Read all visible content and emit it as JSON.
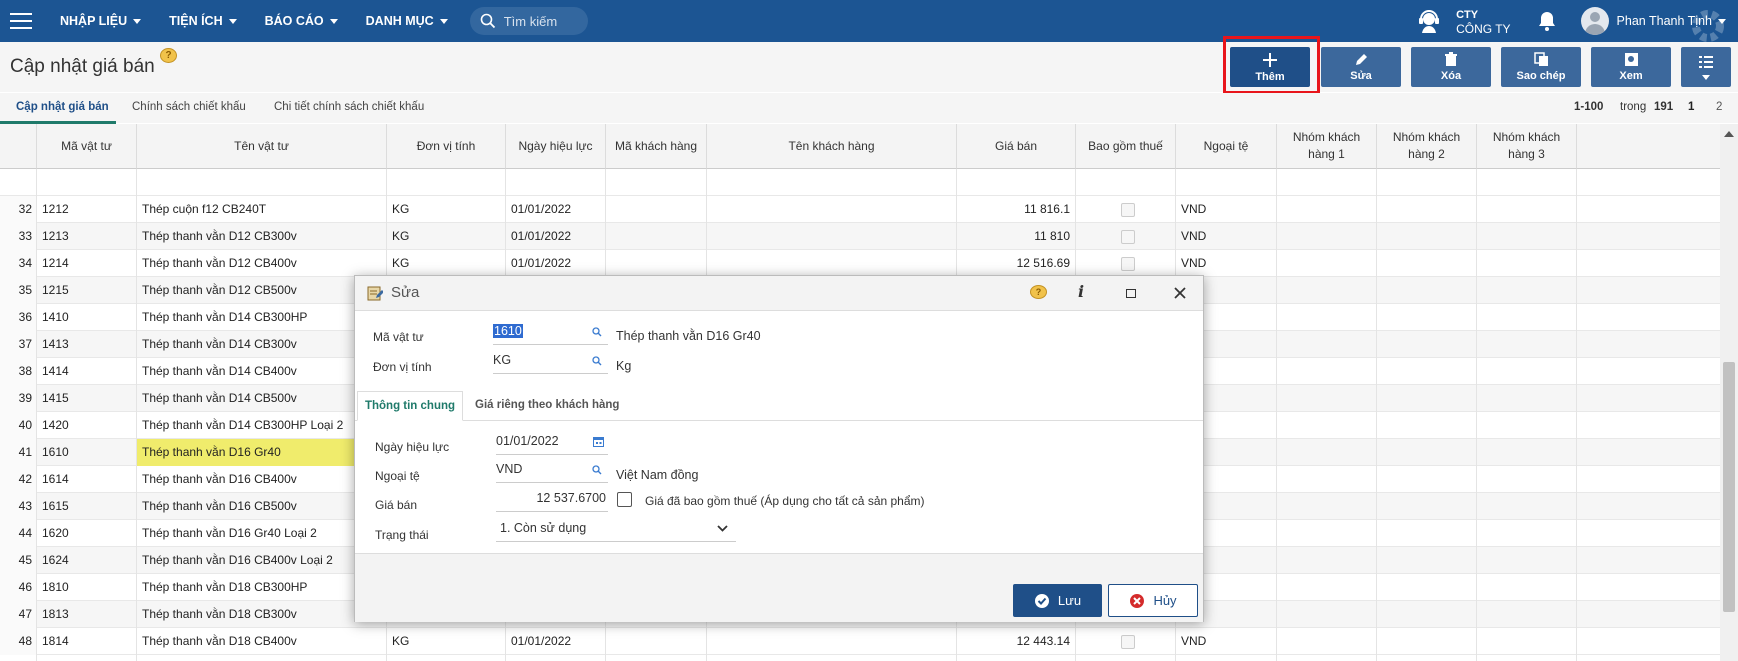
{
  "topbar": {
    "menus": [
      "NHẬP LIỆU",
      "TIỆN ÍCH",
      "BÁO CÁO",
      "DANH MỤC"
    ],
    "search_placeholder": "Tìm kiếm",
    "company_top": "CTY",
    "company_bottom": "CÔNG TY",
    "user": "Phan Thanh Tịnh"
  },
  "page": {
    "title": "Cập nhật giá bán",
    "help": "?"
  },
  "toolbar": {
    "add": "Thêm",
    "edit": "Sửa",
    "delete": "Xóa",
    "copy": "Sao chép",
    "view": "Xem"
  },
  "tabs": [
    "Cập nhật giá bán",
    "Chính sách chiết khấu",
    "Chi tiết chính sách chiết khấu"
  ],
  "pager": {
    "range": "1-100",
    "of": "trong",
    "total": "191",
    "page1": "1",
    "page2": "2"
  },
  "columns": [
    "Mã vật tư",
    "Tên vật tư",
    "Đơn vị tính",
    "Ngày hiệu lực",
    "Mã khách hàng",
    "Tên khách hàng",
    "Giá bán",
    "Bao gồm thuế",
    "Ngoại tệ",
    "Nhóm khách hàng 1",
    "Nhóm khách hàng 2",
    "Nhóm khách hàng 3"
  ],
  "rows": [
    {
      "n": "32",
      "code": "1212",
      "name": "Thép cuộn f12 CB240T",
      "unit": "KG",
      "date": "01/01/2022",
      "price": "11 816.1",
      "cur": "VND"
    },
    {
      "n": "33",
      "code": "1213",
      "name": "Thép thanh vằn D12 CB300v",
      "unit": "KG",
      "date": "01/01/2022",
      "price": "11 810",
      "cur": "VND"
    },
    {
      "n": "34",
      "code": "1214",
      "name": "Thép thanh vằn D12 CB400v",
      "unit": "KG",
      "date": "01/01/2022",
      "price": "12 516.69",
      "cur": "VND"
    },
    {
      "n": "35",
      "code": "1215",
      "name": "Thép thanh vằn D12 CB500v",
      "unit": "",
      "date": "",
      "price": "",
      "cur": ""
    },
    {
      "n": "36",
      "code": "1410",
      "name": "Thép thanh vằn D14 CB300HP",
      "unit": "",
      "date": "",
      "price": "",
      "cur": ""
    },
    {
      "n": "37",
      "code": "1413",
      "name": "Thép thanh vằn D14 CB300v",
      "unit": "",
      "date": "",
      "price": "",
      "cur": ""
    },
    {
      "n": "38",
      "code": "1414",
      "name": "Thép thanh vằn D14 CB400v",
      "unit": "",
      "date": "",
      "price": "",
      "cur": ""
    },
    {
      "n": "39",
      "code": "1415",
      "name": "Thép thanh vằn D14 CB500v",
      "unit": "",
      "date": "",
      "price": "",
      "cur": ""
    },
    {
      "n": "40",
      "code": "1420",
      "name": "Thép thanh vằn D14 CB300HP Loại 2",
      "unit": "",
      "date": "",
      "price": "",
      "cur": ""
    },
    {
      "n": "41",
      "code": "1610",
      "name": "Thép thanh vằn D16 Gr40",
      "unit": "",
      "date": "",
      "price": "",
      "cur": ""
    },
    {
      "n": "42",
      "code": "1614",
      "name": "Thép thanh vằn D16 CB400v",
      "unit": "",
      "date": "",
      "price": "",
      "cur": ""
    },
    {
      "n": "43",
      "code": "1615",
      "name": "Thép thanh vằn D16 CB500v",
      "unit": "",
      "date": "",
      "price": "",
      "cur": ""
    },
    {
      "n": "44",
      "code": "1620",
      "name": "Thép thanh vằn D16 Gr40 Loại 2",
      "unit": "",
      "date": "",
      "price": "",
      "cur": ""
    },
    {
      "n": "45",
      "code": "1624",
      "name": "Thép thanh vằn D16 CB400v Loại 2",
      "unit": "",
      "date": "",
      "price": "",
      "cur": ""
    },
    {
      "n": "46",
      "code": "1810",
      "name": "Thép thanh vằn D18 CB300HP",
      "unit": "",
      "date": "",
      "price": "",
      "cur": ""
    },
    {
      "n": "47",
      "code": "1813",
      "name": "Thép thanh vằn D18 CB300v",
      "unit": "",
      "date": "",
      "price": "",
      "cur": ""
    },
    {
      "n": "48",
      "code": "1814",
      "name": "Thép thanh vằn D18 CB400v",
      "unit": "KG",
      "date": "01/01/2022",
      "price": "12 443.14",
      "cur": "VND"
    }
  ],
  "dialog": {
    "title": "Sửa",
    "item_label": "Mã vật tư",
    "item_code": "1610",
    "item_name": "Thép thanh vằn D16 Gr40",
    "unit_label": "Đơn vị tính",
    "unit_code": "KG",
    "unit_name": "Kg",
    "tab1": "Thông tin chung",
    "tab2": "Giá riêng theo khách hàng",
    "date_label": "Ngày hiệu lực",
    "date_value": "01/01/2022",
    "cur_label": "Ngoại tệ",
    "cur_code": "VND",
    "cur_name": "Việt Nam đồng",
    "price_label": "Giá bán",
    "price_value": "12 537.6700",
    "tax_label": "Giá đã bao gồm thuế (Áp dụng cho tất cả sản phẩm)",
    "status_label": "Trạng thái",
    "status_value": "1. Còn sử dụng",
    "save": "Lưu",
    "cancel": "Hủy"
  }
}
